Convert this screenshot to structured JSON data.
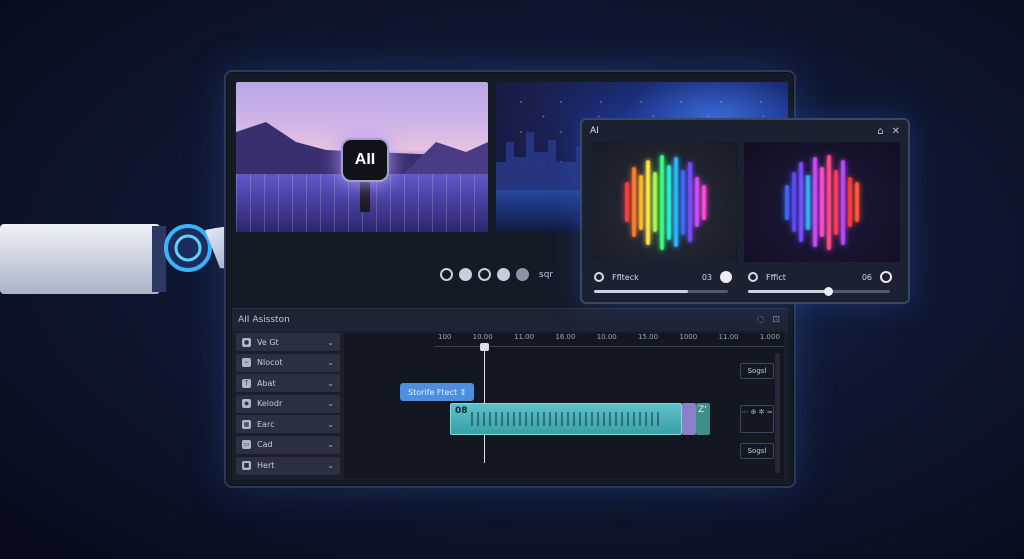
{
  "preview": {
    "left_badge": "AII"
  },
  "playback": {
    "label": "sqr"
  },
  "editor": {
    "title": "AII Asisston",
    "tracks": [
      {
        "label": "Ve Gt",
        "icon": "circle-icon"
      },
      {
        "label": "Nlocot",
        "icon": "wave-icon"
      },
      {
        "label": "Abat",
        "icon": "text-icon"
      },
      {
        "label": "Kelodr",
        "icon": "diamond-icon"
      },
      {
        "label": "Earc",
        "icon": "image-icon"
      },
      {
        "label": "Cad",
        "icon": "caption-icon"
      },
      {
        "label": "Hert",
        "icon": "square-icon"
      }
    ],
    "ruler": [
      "100",
      "10.00",
      "11.00",
      "16.00",
      "10.00",
      "15.00",
      "1000",
      "11.00",
      "1.000"
    ],
    "effect_pill": "Storife Ftect ⇕",
    "clip_label": "08",
    "clip_end_label": "Z'",
    "side_buttons": [
      "Sogsl",
      "Sogsl"
    ],
    "side_mini": "⋯ ⊕\n✲ ≈"
  },
  "popup": {
    "title": "AI",
    "effects": [
      {
        "label": "Fflteck",
        "value": "03"
      },
      {
        "label": "Fffict",
        "value": "06"
      }
    ]
  },
  "colors": {
    "accent": "#4c8fe0",
    "clip": "#5ec3c8"
  }
}
